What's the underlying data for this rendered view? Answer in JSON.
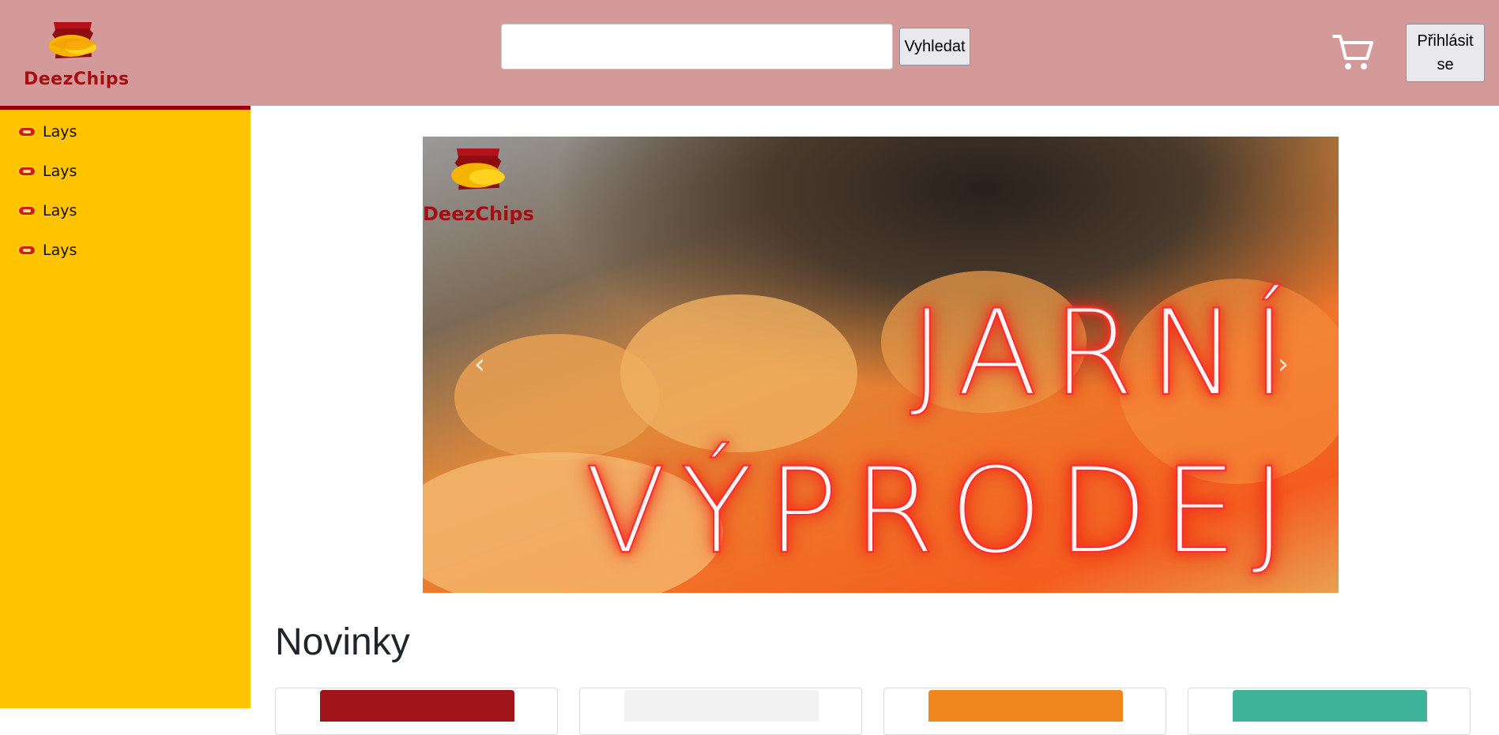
{
  "brand": {
    "name": "DeezChips",
    "color": "#a50e12"
  },
  "header": {
    "background": "#d49a9a",
    "search": {
      "value": "",
      "placeholder": "",
      "button_label": "Vyhledat"
    },
    "cart_icon": "shopping-cart-icon",
    "login_label": "Přihlásit se"
  },
  "sidebar": {
    "background": "#ffc300",
    "items": [
      {
        "label": "Lays",
        "icon": "lays-logo-icon"
      },
      {
        "label": "Lays",
        "icon": "lays-logo-icon"
      },
      {
        "label": "Lays",
        "icon": "lays-logo-icon"
      },
      {
        "label": "Lays",
        "icon": "lays-logo-icon"
      }
    ]
  },
  "carousel": {
    "logo_text": "DeezChips",
    "headline_line1": "JARNÍ",
    "headline_line2": "VÝPRODEJ",
    "prev_icon": "chevron-left-icon",
    "next_icon": "chevron-right-icon"
  },
  "section": {
    "title": "Novinky",
    "products": [
      {
        "pack_color": "#a0141a"
      },
      {
        "pack_color": "#f2f2f2"
      },
      {
        "pack_color": "#f0871e"
      },
      {
        "pack_color": "#3fb39a"
      }
    ]
  }
}
